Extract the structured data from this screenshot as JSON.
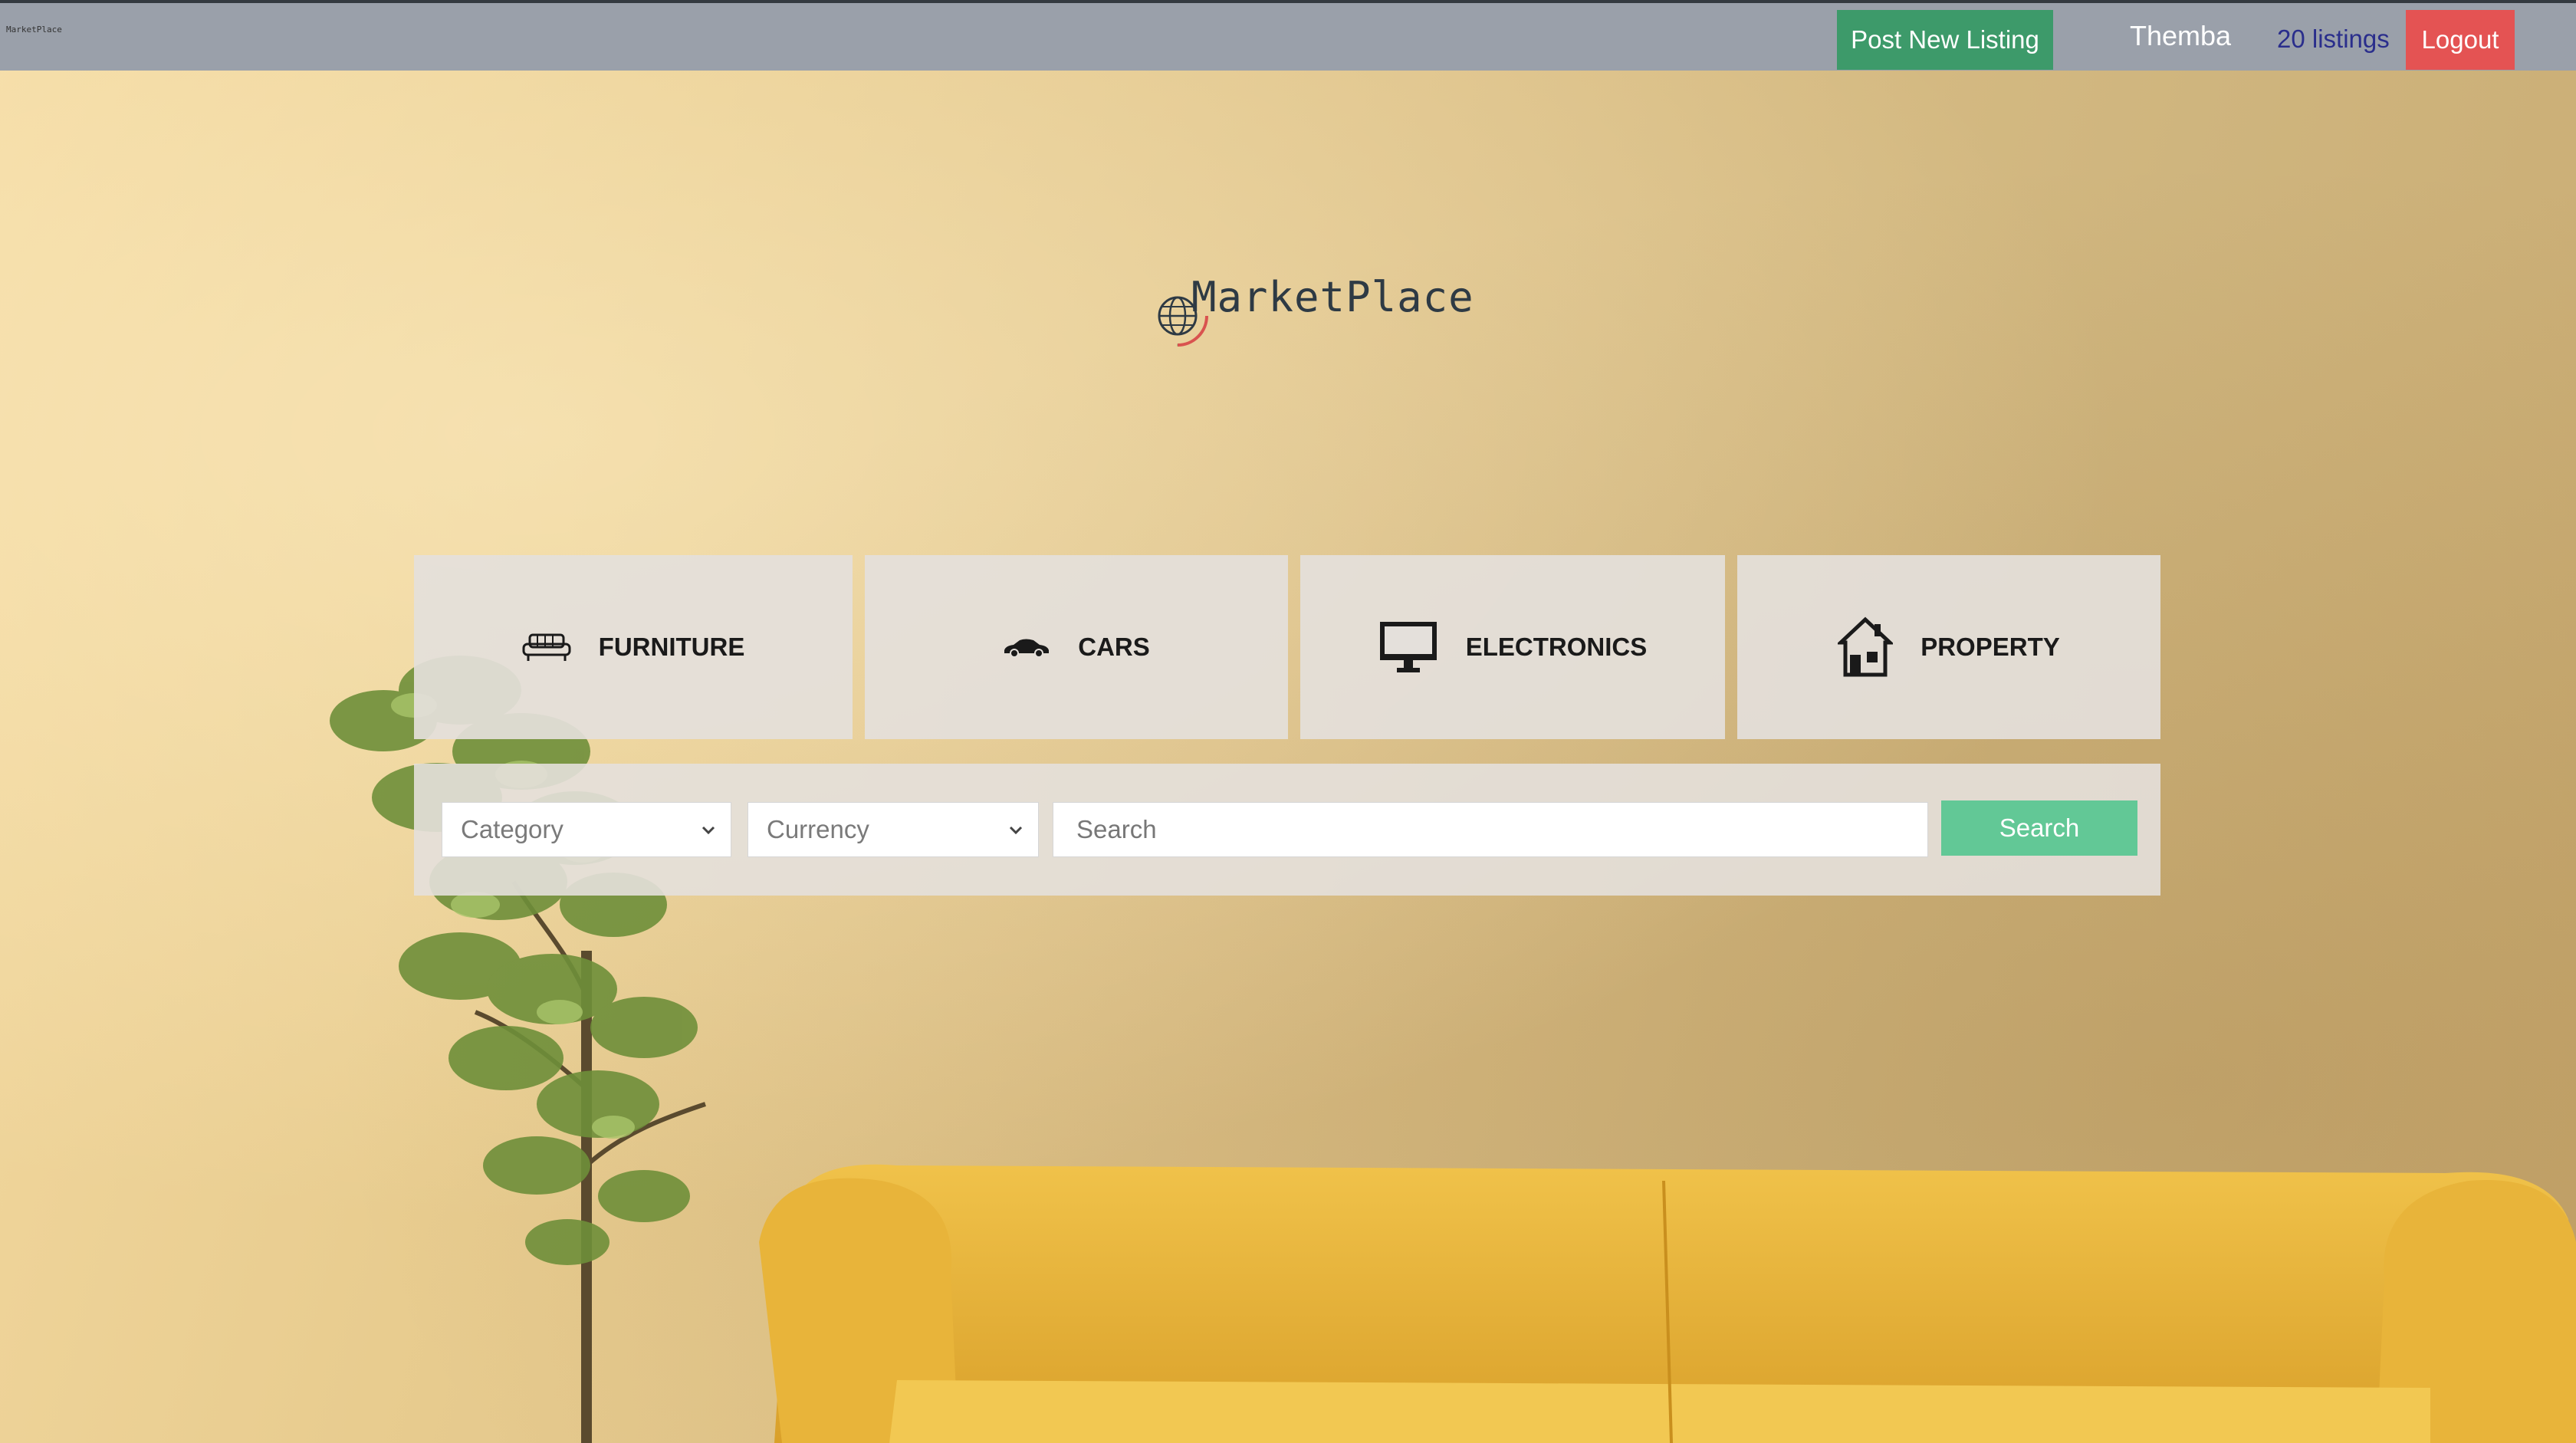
{
  "navbar": {
    "mini_logo_text": "MarketPlace",
    "post_listing_label": "Post New Listing",
    "username": "Themba",
    "listings_count_label": "20 listings",
    "logout_label": "Logout",
    "colors": {
      "bar": "#9aa0aa",
      "post_button": "#3d9a6a",
      "logout_button": "#e45353",
      "listings_link": "#2a2e8c"
    }
  },
  "brand": {
    "name": "MarketPlace",
    "icon": "globe-icon"
  },
  "categories": [
    {
      "label": "FURNITURE",
      "icon": "sofa-icon"
    },
    {
      "label": "CARS",
      "icon": "car-icon"
    },
    {
      "label": "ELECTRONICS",
      "icon": "monitor-icon"
    },
    {
      "label": "PROPERTY",
      "icon": "house-icon"
    }
  ],
  "search": {
    "category_select": "Category",
    "currency_select": "Currency",
    "input_placeholder": "Search",
    "button_label": "Search",
    "button_color": "#62c896"
  },
  "background": {
    "description_icon": "living-room-photo"
  }
}
